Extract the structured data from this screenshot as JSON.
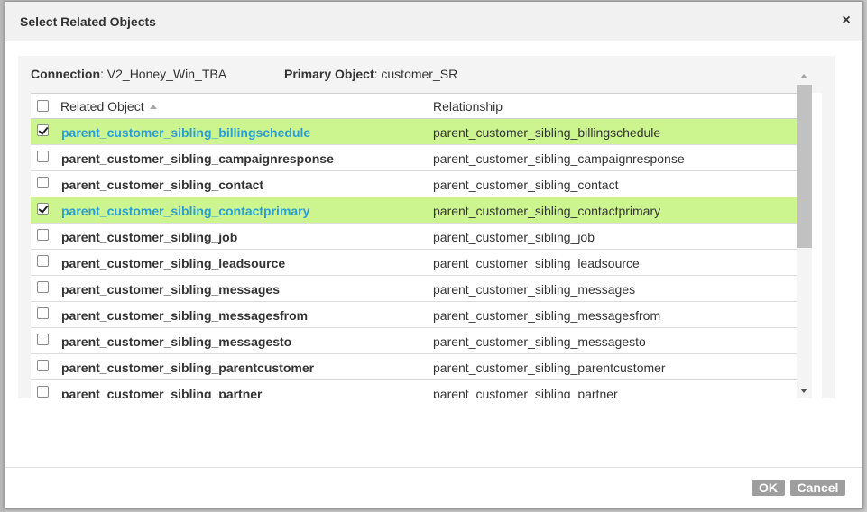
{
  "dialog": {
    "title": "Select Related Objects",
    "close_symbol": "×"
  },
  "info": {
    "connection_label": "Connection",
    "connection_value": ": V2_Honey_Win_TBA",
    "primary_label": "Primary Object",
    "primary_value": ": customer_SR"
  },
  "table": {
    "col_related": "Related Object",
    "col_relationship": "Relationship",
    "rows": [
      {
        "name": "parent_customer_sibling_billingschedule",
        "relationship": "parent_customer_sibling_billingschedule",
        "checked": true
      },
      {
        "name": "parent_customer_sibling_campaignresponse",
        "relationship": "parent_customer_sibling_campaignresponse",
        "checked": false
      },
      {
        "name": "parent_customer_sibling_contact",
        "relationship": "parent_customer_sibling_contact",
        "checked": false
      },
      {
        "name": "parent_customer_sibling_contactprimary",
        "relationship": "parent_customer_sibling_contactprimary",
        "checked": true
      },
      {
        "name": "parent_customer_sibling_job",
        "relationship": "parent_customer_sibling_job",
        "checked": false
      },
      {
        "name": "parent_customer_sibling_leadsource",
        "relationship": "parent_customer_sibling_leadsource",
        "checked": false
      },
      {
        "name": "parent_customer_sibling_messages",
        "relationship": "parent_customer_sibling_messages",
        "checked": false
      },
      {
        "name": "parent_customer_sibling_messagesfrom",
        "relationship": "parent_customer_sibling_messagesfrom",
        "checked": false
      },
      {
        "name": "parent_customer_sibling_messagesto",
        "relationship": "parent_customer_sibling_messagesto",
        "checked": false
      },
      {
        "name": "parent_customer_sibling_parentcustomer",
        "relationship": "parent_customer_sibling_parentcustomer",
        "checked": false
      },
      {
        "name": "parent_customer_sibling_partner",
        "relationship": "parent_customer_sibling_partner",
        "checked": false
      }
    ]
  },
  "footer": {
    "ok_label": "OK",
    "cancel_label": "Cancel"
  },
  "colors": {
    "selected_row": "#ccf58f",
    "selected_text": "#2a9fd6",
    "button_bg": "#9e9e9e"
  }
}
